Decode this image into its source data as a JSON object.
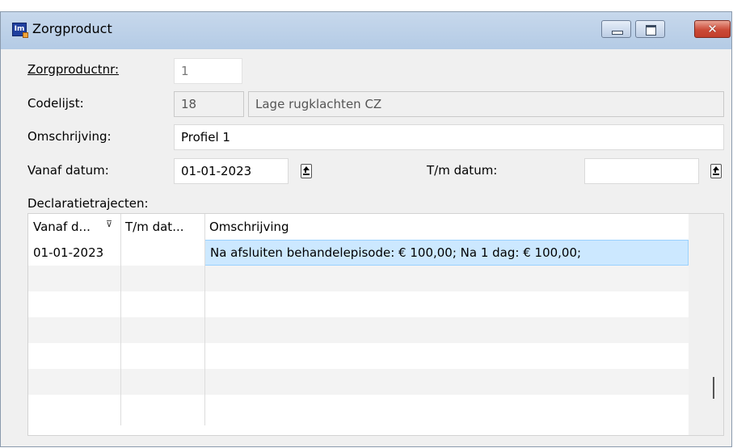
{
  "window": {
    "title": "Zorgproduct",
    "close_glyph": "✕",
    "icon_text": "Im"
  },
  "form": {
    "zorgproductnr": {
      "label": "Zorgproductnr:",
      "value": "1"
    },
    "codelijst": {
      "label": "Codelijst:",
      "code": "18",
      "description": "Lage rugklachten CZ"
    },
    "omschrijving": {
      "label": "Omschrijving:",
      "value": "Profiel 1"
    },
    "vanaf_datum": {
      "label": "Vanaf datum:",
      "value": "01-01-2023"
    },
    "tm_datum": {
      "label": "T/m datum:",
      "value": ""
    }
  },
  "grid": {
    "title": "Declaratietrajecten:",
    "columns": [
      "Vanaf d...",
      "T/m dat...",
      "Omschrijving"
    ],
    "filter_glyph": "⊽",
    "rows": [
      {
        "vanaf": "01-01-2023",
        "tm": "",
        "omschrijving": "Na afsluiten behandelepisode: € 100,00; Na 1 dag: € 100,00;"
      }
    ]
  },
  "icons": [
    "app-icon",
    "minimize-icon",
    "maximize-icon",
    "close-icon",
    "date-picker-icon",
    "filter-icon"
  ]
}
